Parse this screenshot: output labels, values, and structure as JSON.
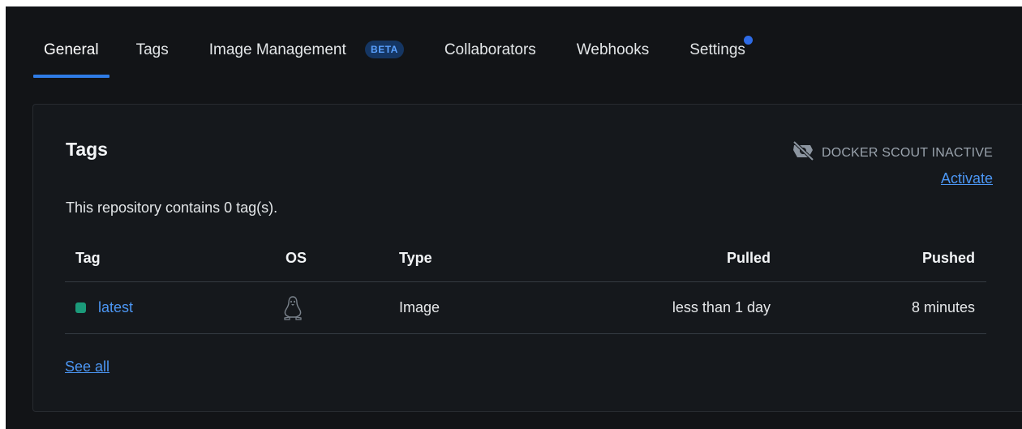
{
  "tabs": [
    {
      "label": "General",
      "active": true
    },
    {
      "label": "Tags"
    },
    {
      "label": "Image Management",
      "badge": "BETA"
    },
    {
      "label": "Collaborators"
    },
    {
      "label": "Webhooks"
    },
    {
      "label": "Settings",
      "notification": true
    }
  ],
  "card": {
    "title": "Tags",
    "scout_status": "DOCKER SCOUT INACTIVE",
    "scout_action": "Activate",
    "description": "This repository contains 0 tag(s).",
    "table": {
      "headers": {
        "tag": "Tag",
        "os": "OS",
        "type": "Type",
        "pulled": "Pulled",
        "pushed": "Pushed"
      },
      "rows": [
        {
          "tag": "latest",
          "os_icon": "linux-icon",
          "type": "Image",
          "pulled": "less than 1 day",
          "pushed": "8 minutes"
        }
      ]
    },
    "see_all": "See all"
  },
  "colors": {
    "background": "#121417",
    "accent": "#2f7ce6",
    "link": "#4c97f5",
    "tag_status": "#1b9a7a",
    "badge_bg": "#153663"
  }
}
